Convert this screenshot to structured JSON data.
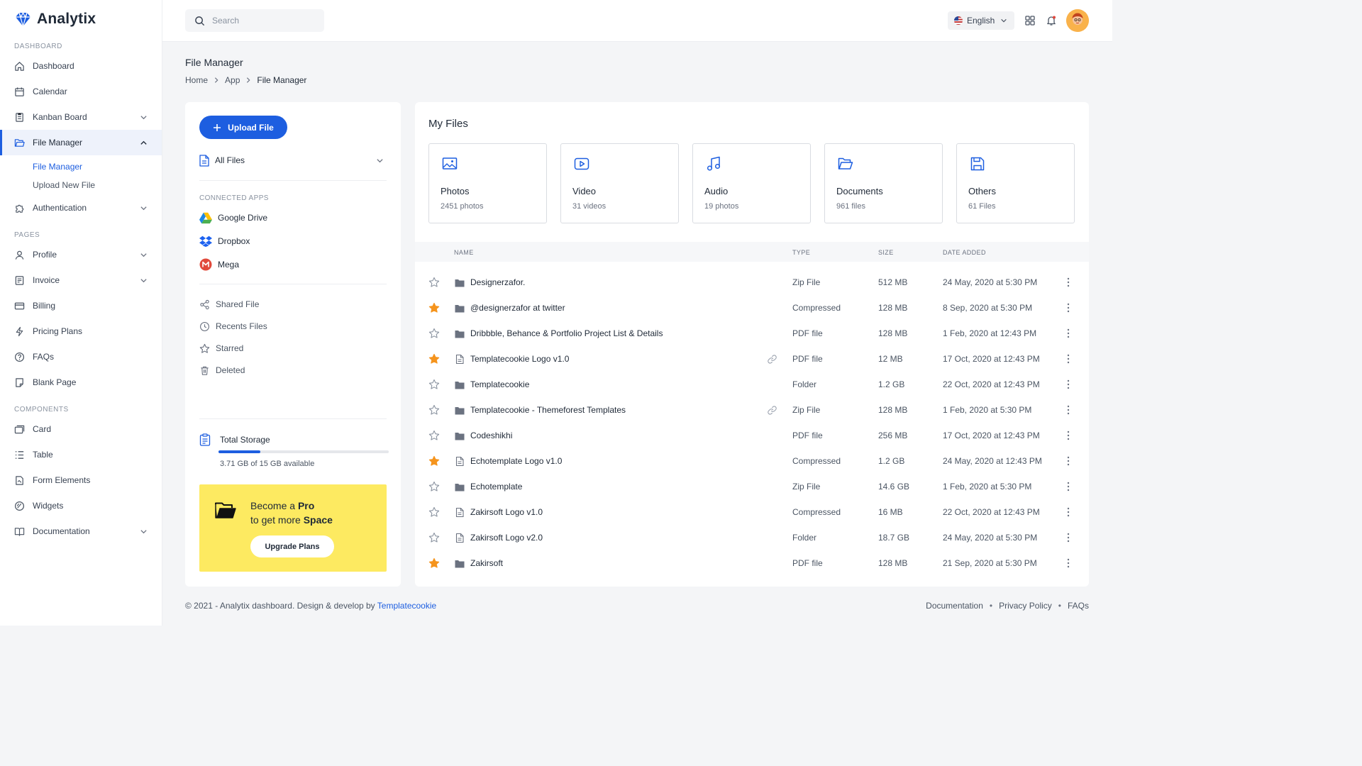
{
  "brand": {
    "name": "Analytix"
  },
  "sidebar": {
    "sections": [
      {
        "title": "DASHBOARD",
        "items": [
          {
            "label": "Dashboard",
            "icon": "home-icon"
          },
          {
            "label": "Calendar",
            "icon": "calendar-icon"
          },
          {
            "label": "Kanban Board",
            "icon": "kanban-icon",
            "expandable": true
          },
          {
            "label": "File Manager",
            "icon": "folder-icon",
            "expandable": true,
            "expanded": true,
            "active": true,
            "children": [
              {
                "label": "File Manager",
                "active": true
              },
              {
                "label": "Upload New File"
              }
            ]
          },
          {
            "label": "Authentication",
            "icon": "puzzle-icon",
            "expandable": true
          }
        ]
      },
      {
        "title": "PAGES",
        "items": [
          {
            "label": "Profile",
            "icon": "user-icon",
            "expandable": true
          },
          {
            "label": "Invoice",
            "icon": "invoice-icon",
            "expandable": true
          },
          {
            "label": "Billing",
            "icon": "credit-card-icon"
          },
          {
            "label": "Pricing Plans",
            "icon": "bolt-icon"
          },
          {
            "label": "FAQs",
            "icon": "question-icon"
          },
          {
            "label": "Blank Page",
            "icon": "page-icon"
          }
        ]
      },
      {
        "title": "COMPONENTS",
        "items": [
          {
            "label": "Card",
            "icon": "card-icon"
          },
          {
            "label": "Table",
            "icon": "table-icon"
          },
          {
            "label": "Form Elements",
            "icon": "form-icon"
          },
          {
            "label": "Widgets",
            "icon": "widget-icon"
          },
          {
            "label": "Documentation",
            "icon": "book-icon",
            "expandable": true
          }
        ]
      }
    ]
  },
  "topbar": {
    "search_placeholder": "Search",
    "language": "English"
  },
  "page": {
    "title": "File Manager",
    "breadcrumb": [
      "Home",
      "App",
      "File Manager"
    ]
  },
  "left_panel": {
    "upload_label": "Upload File",
    "all_files_label": "All Files",
    "connected_apps_title": "CONNECTED APPS",
    "apps": [
      {
        "label": "Google Drive",
        "icon": "google-drive-icon"
      },
      {
        "label": "Dropbox",
        "icon": "dropbox-icon"
      },
      {
        "label": "Mega",
        "icon": "mega-icon"
      }
    ],
    "links": [
      {
        "label": "Shared File",
        "icon": "share-icon"
      },
      {
        "label": "Recents Files",
        "icon": "clock-icon"
      },
      {
        "label": "Starred",
        "icon": "star-icon"
      },
      {
        "label": "Deleted",
        "icon": "trash-icon"
      }
    ],
    "storage": {
      "title": "Total Storage",
      "used_fraction": 0.247,
      "available_text": "3.71 GB of 15 GB available"
    },
    "promo": {
      "line1_prefix": "Become a ",
      "line1_bold": "Pro",
      "line2_prefix": "to get more ",
      "line2_bold": "Space",
      "button_label": "Upgrade Plans"
    }
  },
  "main": {
    "title": "My Files",
    "categories": [
      {
        "name": "Photos",
        "count": "2451 photos",
        "icon": "image-icon"
      },
      {
        "name": "Video",
        "count": "31 videos",
        "icon": "video-icon"
      },
      {
        "name": "Audio",
        "count": "19 photos",
        "icon": "music-icon"
      },
      {
        "name": "Documents",
        "count": "961 files",
        "icon": "documents-folder-icon"
      },
      {
        "name": "Others",
        "count": "61 Files",
        "icon": "save-icon"
      }
    ],
    "columns": [
      "NAME",
      "TYPE",
      "SIZE",
      "DATE ADDED"
    ],
    "files": [
      {
        "name": "Designerzafor.",
        "type": "Zip File",
        "size": "512 MB",
        "date": "24 May, 2020 at 5:30 PM",
        "starred": false,
        "kind": "folder",
        "linked": false
      },
      {
        "name": "@designerzafor at twitter",
        "type": "Compressed",
        "size": "128 MB",
        "date": "8 Sep, 2020 at 5:30 PM",
        "starred": true,
        "kind": "folder",
        "linked": false
      },
      {
        "name": "Dribbble, Behance & Portfolio Project List & Details",
        "type": "PDF file",
        "size": "128 MB",
        "date": "1 Feb, 2020 at 12:43 PM",
        "starred": false,
        "kind": "folder",
        "linked": false
      },
      {
        "name": "Templatecookie Logo v1.0",
        "type": "PDF file",
        "size": "12 MB",
        "date": "17 Oct, 2020  at 12:43 PM",
        "starred": true,
        "kind": "file",
        "linked": true
      },
      {
        "name": "Templatecookie",
        "type": "Folder",
        "size": "1.2 GB",
        "date": "22 Oct, 2020 at 12:43 PM",
        "starred": false,
        "kind": "folder",
        "linked": false
      },
      {
        "name": "Templatecookie - Themeforest Templates",
        "type": "Zip File",
        "size": "128 MB",
        "date": "1 Feb, 2020 at 5:30 PM",
        "starred": false,
        "kind": "folder",
        "linked": true
      },
      {
        "name": "Codeshikhi",
        "type": "PDF file",
        "size": "256 MB",
        "date": "17 Oct, 2020 at 12:43 PM",
        "starred": false,
        "kind": "folder",
        "linked": false
      },
      {
        "name": "Echotemplate Logo v1.0",
        "type": "Compressed",
        "size": "1.2 GB",
        "date": "24 May, 2020 at 12:43 PM",
        "starred": true,
        "kind": "file",
        "linked": false
      },
      {
        "name": "Echotemplate",
        "type": "Zip File",
        "size": "14.6 GB",
        "date": "1 Feb, 2020 at 5:30 PM",
        "starred": false,
        "kind": "folder",
        "linked": false
      },
      {
        "name": "Zakirsoft Logo v1.0",
        "type": "Compressed",
        "size": "16 MB",
        "date": "22 Oct, 2020 at 12:43 PM",
        "starred": false,
        "kind": "file",
        "linked": false
      },
      {
        "name": "Zakirsoft Logo v2.0",
        "type": "Folder",
        "size": "18.7 GB",
        "date": "24 May, 2020 at 5:30 PM",
        "starred": false,
        "kind": "file",
        "linked": false
      },
      {
        "name": "Zakirsoft",
        "type": "PDF file",
        "size": "128 MB",
        "date": "21 Sep, 2020 at 5:30 PM",
        "starred": true,
        "kind": "folder",
        "linked": false
      }
    ]
  },
  "footer": {
    "copyright_prefix": "© 2021 - Analytix dashboard. Design & develop by ",
    "author": "Templatecookie",
    "links": [
      "Documentation",
      "Privacy Policy",
      "FAQs"
    ]
  },
  "colors": {
    "accent": "#1d5ee0",
    "star": "#f5941d",
    "promo": "#fdea61"
  }
}
